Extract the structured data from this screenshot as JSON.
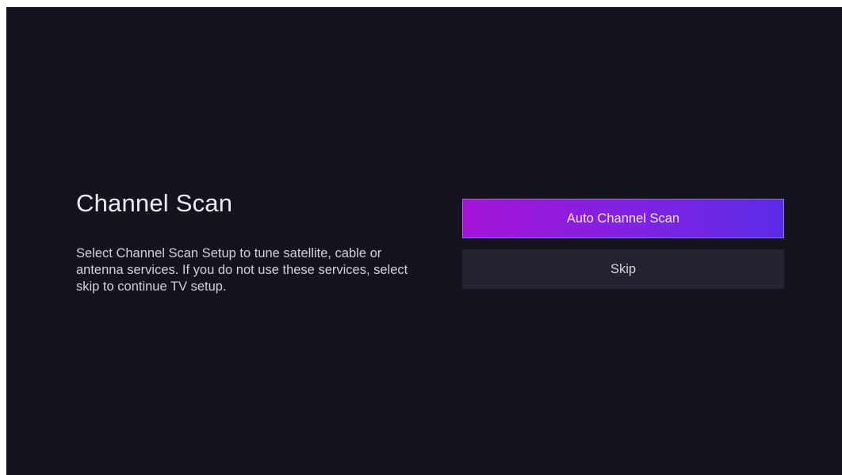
{
  "page": {
    "title": "Channel Scan",
    "description": "Select Channel Scan Setup to tune satellite, cable or antenna services. If you do not use these services, select skip to continue TV setup."
  },
  "actions": {
    "auto_scan_label": "Auto Channel Scan",
    "skip_label": "Skip"
  },
  "colors": {
    "background": "#15131d",
    "primary_gradient_start": "#a514d6",
    "primary_gradient_end": "#5b2be6",
    "secondary_button": "#24232f"
  }
}
